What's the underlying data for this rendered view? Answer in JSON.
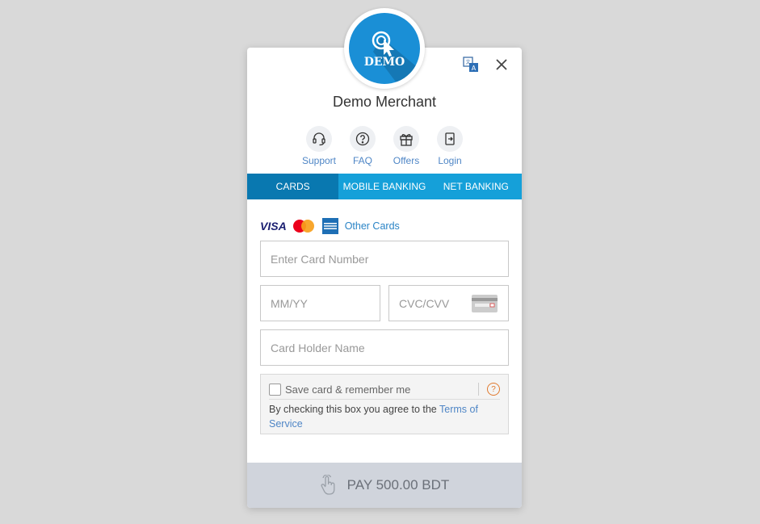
{
  "merchant": {
    "name": "Demo Merchant",
    "logo_text": "DEMO"
  },
  "quick_links": [
    {
      "label": "Support",
      "icon": "headset-icon"
    },
    {
      "label": "FAQ",
      "icon": "question-icon"
    },
    {
      "label": "Offers",
      "icon": "gift-icon"
    },
    {
      "label": "Login",
      "icon": "login-icon"
    }
  ],
  "tabs": [
    {
      "label": "CARDS",
      "active": true
    },
    {
      "label": "MOBILE BANKING",
      "active": false
    },
    {
      "label": "NET BANKING",
      "active": false
    }
  ],
  "card_brands": {
    "visa": "VISA",
    "other_cards": "Other Cards"
  },
  "form": {
    "card_number_placeholder": "Enter Card Number",
    "expiry_placeholder": "MM/YY",
    "cvc_placeholder": "CVC/CVV",
    "holder_placeholder": "Card Holder Name"
  },
  "save_card": {
    "label": "Save card & remember me",
    "help": "?",
    "terms_prefix": "By checking this box you agree to the ",
    "terms_link": "Terms of Service"
  },
  "pay_button": {
    "label": "PAY 500.00 BDT"
  },
  "colors": {
    "tab_bar": "#15a0d9",
    "tab_active": "#0978b0",
    "link": "#4f86c6",
    "pay_bg": "#d0d4dc"
  }
}
